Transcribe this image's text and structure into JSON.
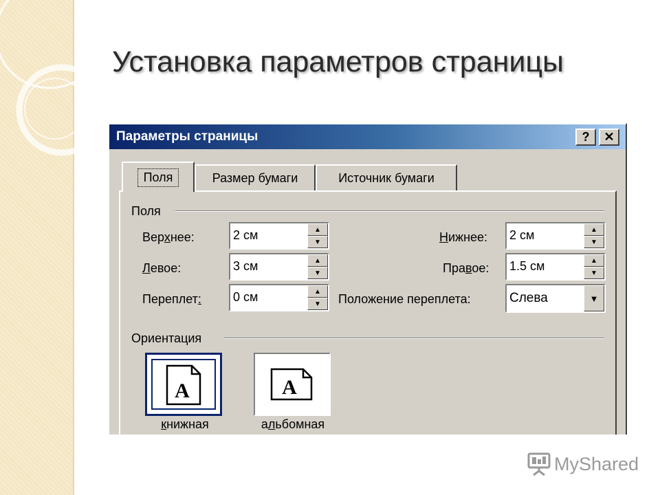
{
  "slide": {
    "title": "Установка параметров страницы"
  },
  "dialog": {
    "title": "Параметры страницы",
    "help_glyph": "?",
    "close_glyph": "✕",
    "tabs": [
      {
        "label": "Поля",
        "active": true
      },
      {
        "label": "Размер бумаги",
        "active": false
      },
      {
        "label": "Источник бумаги",
        "active": false
      }
    ],
    "margins": {
      "group_label": "Поля",
      "top": {
        "label_pre": "Вер",
        "label_key": "х",
        "label_post": "нее:",
        "value": "2 см"
      },
      "left": {
        "label_pre": "",
        "label_key": "Л",
        "label_post": "евое:",
        "value": "3 см"
      },
      "gutter": {
        "label_pre": "Переплет",
        "label_key": ":",
        "label_post": "",
        "value": "0 см"
      },
      "bottom": {
        "label_pre": "",
        "label_key": "Н",
        "label_post": "ижнее:",
        "value": "2 см"
      },
      "right": {
        "label_pre": "Пра",
        "label_key": "в",
        "label_post": "ое:",
        "value": "1.5 см"
      },
      "gutter_position": {
        "label": "Положение переплета:",
        "value": "Слева"
      }
    },
    "orientation": {
      "group_label": "Ориентация",
      "portrait": {
        "key": "к",
        "rest": "нижная",
        "glyph": "A",
        "selected": true
      },
      "landscape": {
        "pre": "а",
        "key": "л",
        "rest": "ьбомная",
        "glyph": "A",
        "selected": false
      }
    }
  },
  "logo": {
    "text": "MyShared",
    "icon": "projector-screen-icon"
  },
  "colors": {
    "dialog_face": "#d4d0c8",
    "title_start": "#0a246a",
    "title_end": "#a6caf0",
    "side_band": "#f4e6c2"
  }
}
